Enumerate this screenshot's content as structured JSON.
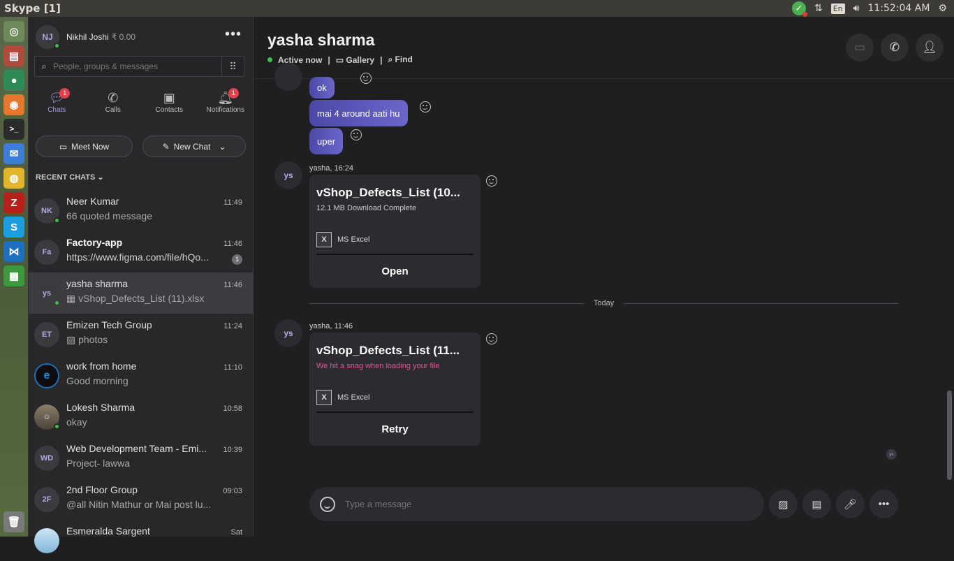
{
  "window": {
    "title": "Skype [1]"
  },
  "tray": {
    "lang": "En",
    "clock": "11:52:04 AM"
  },
  "profile": {
    "initials": "NJ",
    "name": "Nikhil Joshi",
    "balance": "₹ 0.00"
  },
  "search": {
    "placeholder": "People, groups & messages"
  },
  "nav": {
    "tabs": [
      {
        "label": "Chats",
        "badge": "1"
      },
      {
        "label": "Calls"
      },
      {
        "label": "Contacts"
      },
      {
        "label": "Notifications",
        "badge": "1"
      }
    ]
  },
  "actions": {
    "meet_now": "Meet Now",
    "new_chat": "New Chat"
  },
  "recent": {
    "heading": "RECENT CHATS"
  },
  "chats": [
    {
      "initials": "NK",
      "name": "Neer Kumar",
      "time": "11:49",
      "preview": "quoted message",
      "preview_icon": "66"
    },
    {
      "initials": "Fa",
      "name": "Factory-app",
      "time": "11:46",
      "preview": "https://www.figma.com/file/hQo...",
      "unread": "1"
    },
    {
      "initials": "ys",
      "name": "yasha sharma",
      "time": "11:46",
      "preview": "vShop_Defects_List (11).xlsx"
    },
    {
      "initials": "ET",
      "name": "Emizen Tech Group",
      "time": "11:24",
      "preview": "photos"
    },
    {
      "initials": "",
      "name": "work from home",
      "time": "11:10",
      "preview": "Good morning"
    },
    {
      "initials": "",
      "name": "Lokesh Sharma",
      "time": "10:58",
      "preview": "okay"
    },
    {
      "initials": "WD",
      "name": "Web Development Team - Emi...",
      "time": "10:39",
      "preview": "Project- lawwa"
    },
    {
      "initials": "2F",
      "name": "2nd Floor Group",
      "time": "09:03",
      "preview": "@all Nitin Mathur or Mai post lu..."
    },
    {
      "initials": "",
      "name": "Esmeralda Sargent",
      "time": "Sat",
      "preview": ""
    }
  ],
  "conversation": {
    "title": "yasha sharma",
    "status": "Active now",
    "gallery": "Gallery",
    "find": "Find",
    "messages": [
      {
        "text": "ok"
      },
      {
        "text": "mai 4 around aati hu"
      },
      {
        "text": "uper"
      }
    ],
    "file1": {
      "meta": "yasha, 16:24",
      "name": "vShop_Defects_List (10...",
      "status": "12.1 MB Download Complete",
      "type": "MS Excel",
      "action": "Open"
    },
    "day_separator": "Today",
    "file2": {
      "meta": "yasha, 11:46",
      "name": "vShop_Defects_List (11...",
      "status": "We hit a snag when loading your file",
      "type": "MS Excel",
      "action": "Retry"
    },
    "avatar_initials": "ys",
    "read_receipt": "ys"
  },
  "composer": {
    "placeholder": "Type a message"
  },
  "colors": {
    "accent": "#6b67c9",
    "online": "#3fbf4f",
    "badge": "#e5414d",
    "error": "#e2549b"
  }
}
